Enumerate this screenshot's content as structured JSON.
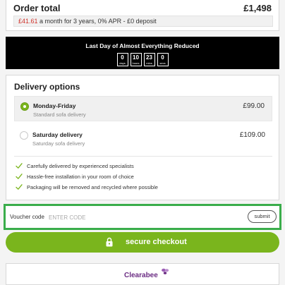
{
  "order": {
    "title": "Order total",
    "amount": "£1,498",
    "finance_price": "£41.61",
    "finance_text": " a month for 3 years, 0% APR - £0 deposit"
  },
  "countdown": {
    "title": "Last Day of Almost Everything Reduced",
    "cells": [
      {
        "value": "0",
        "unit": "days"
      },
      {
        "value": "10",
        "unit": "hours"
      },
      {
        "value": "23",
        "unit": "mins"
      },
      {
        "value": "0",
        "unit": "secs"
      }
    ]
  },
  "delivery": {
    "title": "Delivery options",
    "options": [
      {
        "name": "Monday-Friday",
        "sub": "Standard sofa delivery",
        "price": "£99.00",
        "selected": true
      },
      {
        "name": "Saturday delivery",
        "sub": "Saturday sofa delivery",
        "price": "£109.00",
        "selected": false
      }
    ],
    "benefits": [
      "Carefully delivered by experienced specialists",
      "Hassle-free installation in your room of choice",
      "Packaging will be removed and recycled where possible"
    ]
  },
  "voucher": {
    "label": "Voucher code",
    "placeholder": "ENTER CODE",
    "submit_label": "submit"
  },
  "checkout": {
    "label": "secure checkout"
  },
  "partner": {
    "logo_text": "Clearabee"
  },
  "colors": {
    "accent_green": "#7ab51d",
    "highlight_green": "#3aad4b",
    "finance_red": "#d0322b",
    "partner_purple": "#6b2c83"
  }
}
